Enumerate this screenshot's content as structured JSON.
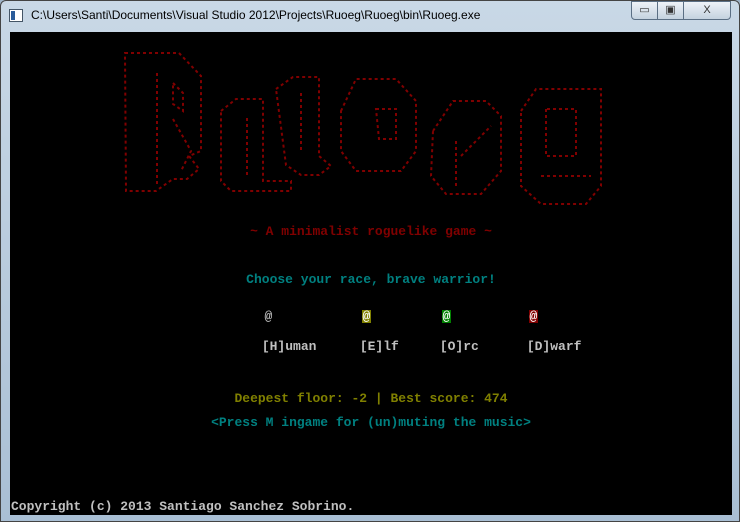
{
  "window": {
    "title": "C:\\Users\\Santi\\Documents\\Visual Studio 2012\\Projects\\Ruoeg\\Ruoeg\\bin\\Ruoeg.exe",
    "minimize": "▭",
    "maximize": "▣",
    "close": "X"
  },
  "logo": {
    "text": "Ruoeg",
    "color": "#800000"
  },
  "subtitle": "~ A minimalist roguelike game ~",
  "prompt": "Choose your race, brave warrior!",
  "races": [
    {
      "symbol": "@",
      "label": "[H]uman",
      "fg": "#c0c0c0",
      "bg": "transparent"
    },
    {
      "symbol": "@",
      "label": "[E]lf",
      "fg": "#ffffff",
      "bg": "#808000"
    },
    {
      "symbol": "@",
      "label": "[O]rc",
      "fg": "#ffffff",
      "bg": "#008000"
    },
    {
      "symbol": "@",
      "label": "[D]warf",
      "fg": "#ffffff",
      "bg": "#800000"
    }
  ],
  "stats": "Deepest floor: -2 | Best score: 474",
  "hint": "<Press M ingame for (un)muting the music>",
  "copyright": "Copyright (c) 2013 Santiago Sanchez Sobrino."
}
